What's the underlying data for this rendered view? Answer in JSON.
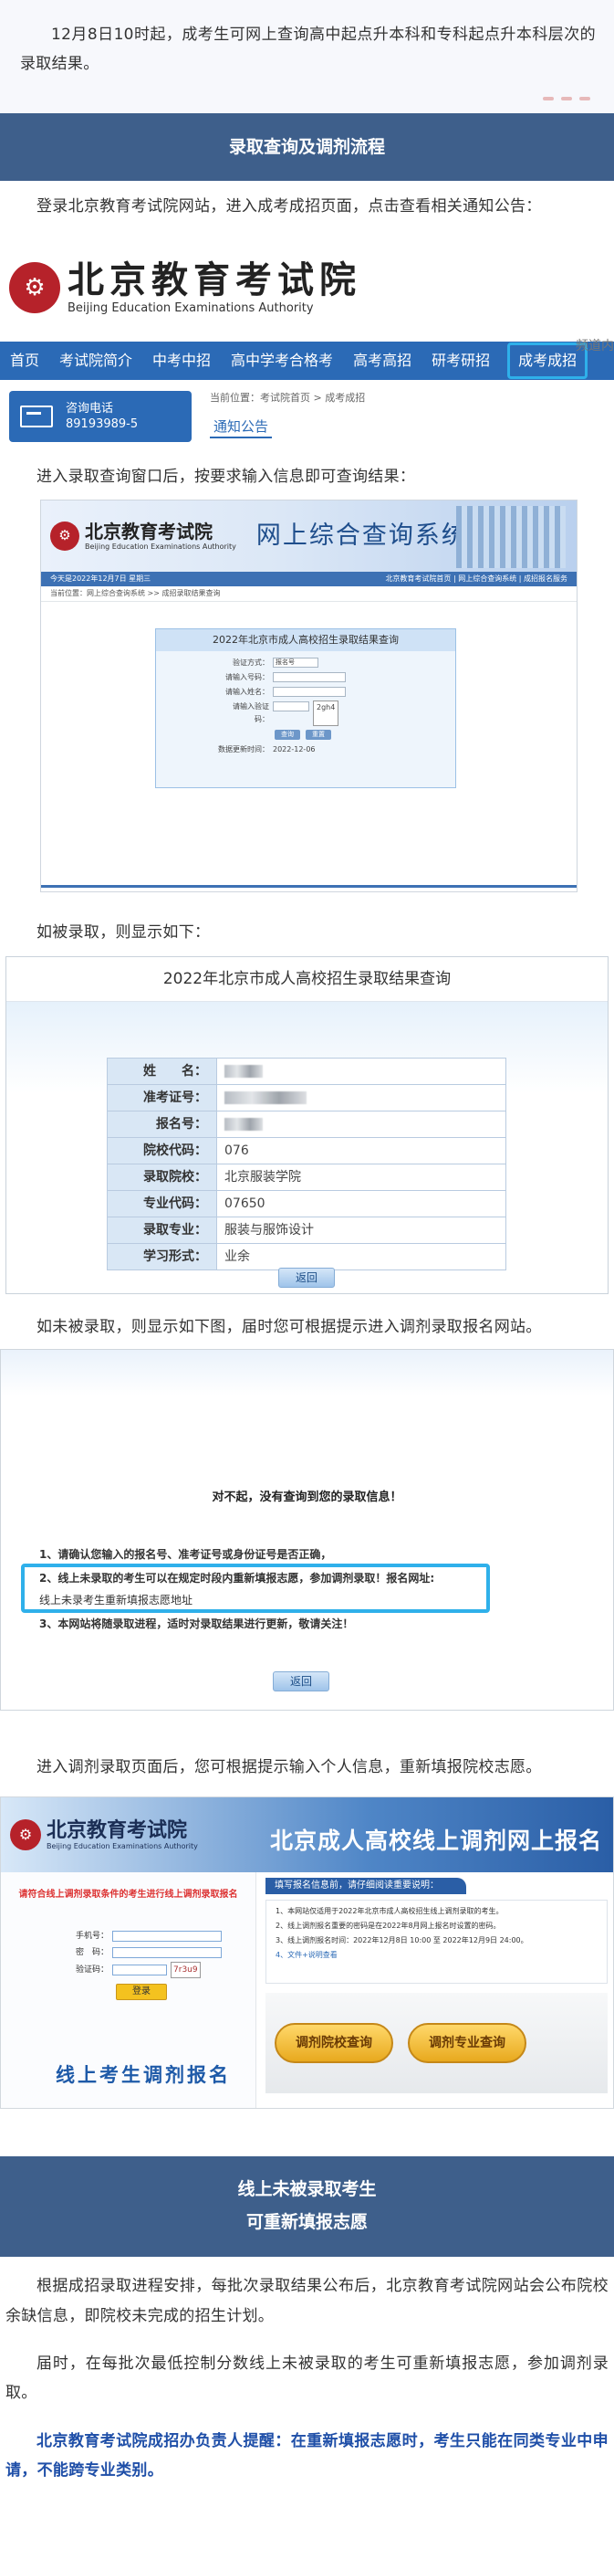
{
  "intro": {
    "text": "12月8日10时起，成考生可网上查询高中起点升本科和专科起点升本科层次的录取结果。"
  },
  "section1": {
    "title": "录取查询及调剂流程",
    "step1": "登录北京教育考试院网站，进入成考成招页面，点击查看相关通知公告：",
    "step2": "进入录取查询窗口后，按要求输入信息即可查询结果：",
    "step3": "如被录取，则显示如下：",
    "step4": "如未被录取，则显示如下图，届时您可根据提示进入调剂录取报名网站。",
    "step5": "进入调剂录取页面后，您可根据提示输入个人信息，重新填报院校志愿。"
  },
  "shot_site": {
    "logo_cn": "北京教育考试院",
    "logo_en": "Beijing Education Examinations Authority",
    "nav": [
      "首页",
      "考试院简介",
      "中考中招",
      "高中学考合格考",
      "高考高招",
      "研考研招",
      "成考成招"
    ],
    "hotline_label": "咨询电话",
    "hotline_number": "89193989-5",
    "crumb": "当前位置：考试院首页 > 成考成招",
    "notice": "通知公告",
    "right_cut": "频道内"
  },
  "shot_query": {
    "logo_cn": "北京教育考试院",
    "logo_en": "Beijing Education Examinations Authority",
    "system_title": "网上综合查询系统",
    "bar_left": "今天是2022年12月7日 星期三",
    "bar_right": "北京教育考试院首页 | 网上综合查询系统 | 成招报名服务",
    "sub": "当前位置：网上综合查询系统 >> 成招录取结果查询",
    "box_title": "2022年北京市成人高校招生录取结果查询",
    "fields": [
      "验证方式：",
      "请输入号码：",
      "请输入姓名：",
      "请输入验证码："
    ],
    "select_val": "报名号",
    "captcha": "2gh4",
    "btn_query": "查询",
    "btn_reset": "重置",
    "time_label": "数据更新时间：",
    "time": "2022-12-06"
  },
  "shot_result": {
    "title": "2022年北京市成人高校招生录取结果查询",
    "rows": [
      {
        "k": "姓　　名：",
        "v": ""
      },
      {
        "k": "准考证号：",
        "v": ""
      },
      {
        "k": "报名号：",
        "v": ""
      },
      {
        "k": "院校代码：",
        "v": "076"
      },
      {
        "k": "录取院校：",
        "v": "北京服装学院"
      },
      {
        "k": "专业代码：",
        "v": "07650"
      },
      {
        "k": "录取专业：",
        "v": "服装与服饰设计"
      },
      {
        "k": "学习形式：",
        "v": "业余"
      }
    ],
    "back": "返回"
  },
  "shot_fail": {
    "sorry": "对不起，没有查询到您的录取信息！",
    "l1": "1、请确认您输入的报名号、准考证号或身份证号是否正确，",
    "l2": "2、线上未录取的考生可以在规定时段内重新填报志愿，参加调剂录取！报名网址:",
    "l2b": "线上未录考生重新填报志愿地址",
    "l3": "3、本网站将随录取进程，适时对录取结果进行更新，敬请关注！",
    "back": "返回"
  },
  "shot_adjust": {
    "logo_cn": "北京教育考试院",
    "logo_en": "Beijing Education Examinations Authority",
    "title": "北京成人高校线上调剂网上报名",
    "tip": "请符合线上调剂录取条件的考生进行线上调剂录取报名",
    "f_phone": "手机号：",
    "f_pwd": "密　码：",
    "f_code": "验证码：",
    "captcha": "7r3u9",
    "login": "登录",
    "foot": "线上考生调剂报名",
    "notice_title": "填写报名信息前，请仔细阅读重要说明：",
    "notices": [
      "1、本网站仅适用于2022年北京市成人高校招生线上调剂录取的考生。",
      "2、线上调剂报名重要的密码是在2022年8月网上报名时设置的密码。",
      "3、线上调剂报名时间：2022年12月8日 10:00 至 2022年12月9日 24:00。",
      "4、文件+说明查看"
    ],
    "btn1": "调剂院校查询",
    "btn2": "调剂专业查询"
  },
  "section2": {
    "title1": "线上未被录取考生",
    "title2": "可重新填报志愿",
    "p1": "根据成招录取进程安排，每批次录取结果公布后，北京教育考试院网站会公布院校余缺信息，即院校未完成的招生计划。",
    "p2": "届时，在每批次最低控制分数线上未被录取的考生可重新填报志愿，参加调剂录取。",
    "p3": "北京教育考试院成招办负责人提醒：在重新填报志愿时，考生只能在同类专业中申请，不能跨专业类别。"
  },
  "colors": {
    "banner": "#3e5f8b",
    "nav": "#2b6ab6",
    "highlight": "#2fb0ea",
    "reminder": "#1f4fa8"
  }
}
